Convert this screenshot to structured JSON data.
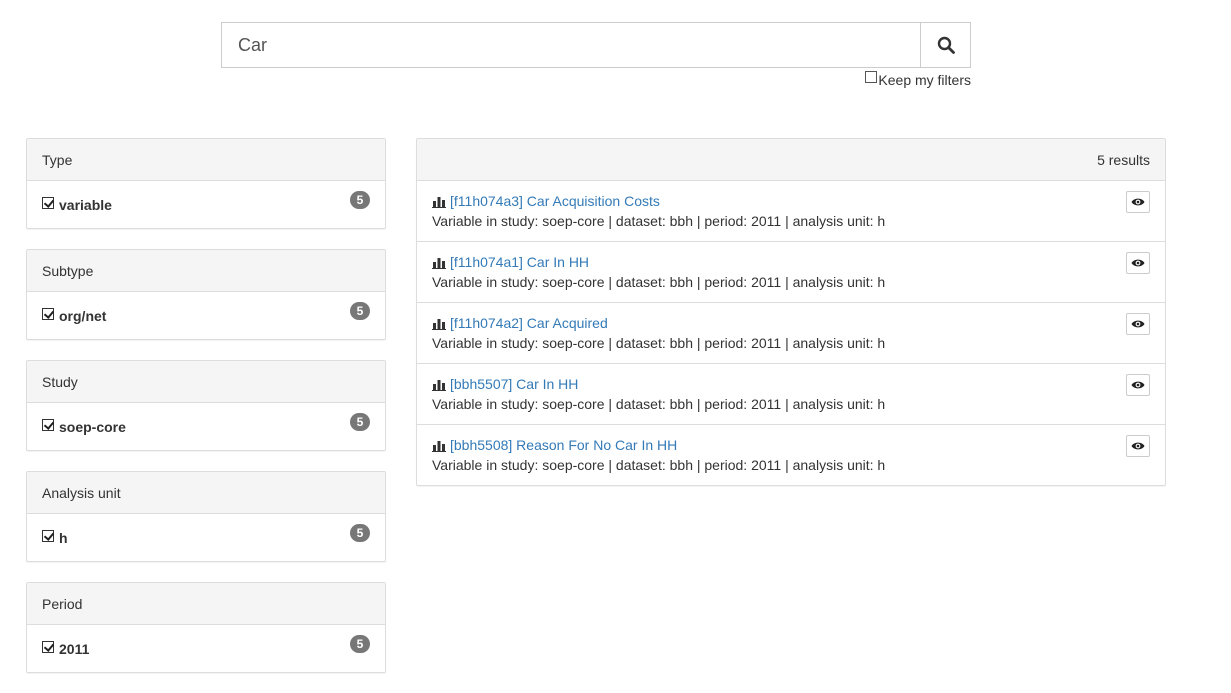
{
  "search": {
    "value": "Car",
    "placeholder": ""
  },
  "keep_filters": {
    "label": "Keep my filters",
    "checked": false
  },
  "facets": [
    {
      "heading": "Type",
      "option": "variable",
      "count": "5"
    },
    {
      "heading": "Subtype",
      "option": "org/net",
      "count": "5"
    },
    {
      "heading": "Study",
      "option": "soep-core",
      "count": "5"
    },
    {
      "heading": "Analysis unit",
      "option": "h",
      "count": "5"
    },
    {
      "heading": "Period",
      "option": "2011",
      "count": "5"
    }
  ],
  "results": {
    "count_label": "5 results",
    "items": [
      {
        "title": "[f11h074a3] Car Acquisition Costs",
        "description": "Variable in study: soep-core | dataset: bbh | period: 2011 | analysis unit: h"
      },
      {
        "title": "[f11h074a1] Car In HH",
        "description": "Variable in study: soep-core | dataset: bbh | period: 2011 | analysis unit: h"
      },
      {
        "title": "[f11h074a2] Car Acquired",
        "description": "Variable in study: soep-core | dataset: bbh | period: 2011 | analysis unit: h"
      },
      {
        "title": "[bbh5507] Car In HH",
        "description": "Variable in study: soep-core | dataset: bbh | period: 2011 | analysis unit: h"
      },
      {
        "title": "[bbh5508] Reason For No Car In HH",
        "description": "Variable in study: soep-core | dataset: bbh | period: 2011 | analysis unit: h"
      }
    ]
  },
  "icons": {
    "search": "search-icon",
    "preview": "eye-icon",
    "variable": "bar-chart-icon"
  },
  "colors": {
    "link": "#337ab7",
    "badge": "#777777",
    "panel_heading": "#f5f5f5",
    "border": "#dddddd"
  }
}
